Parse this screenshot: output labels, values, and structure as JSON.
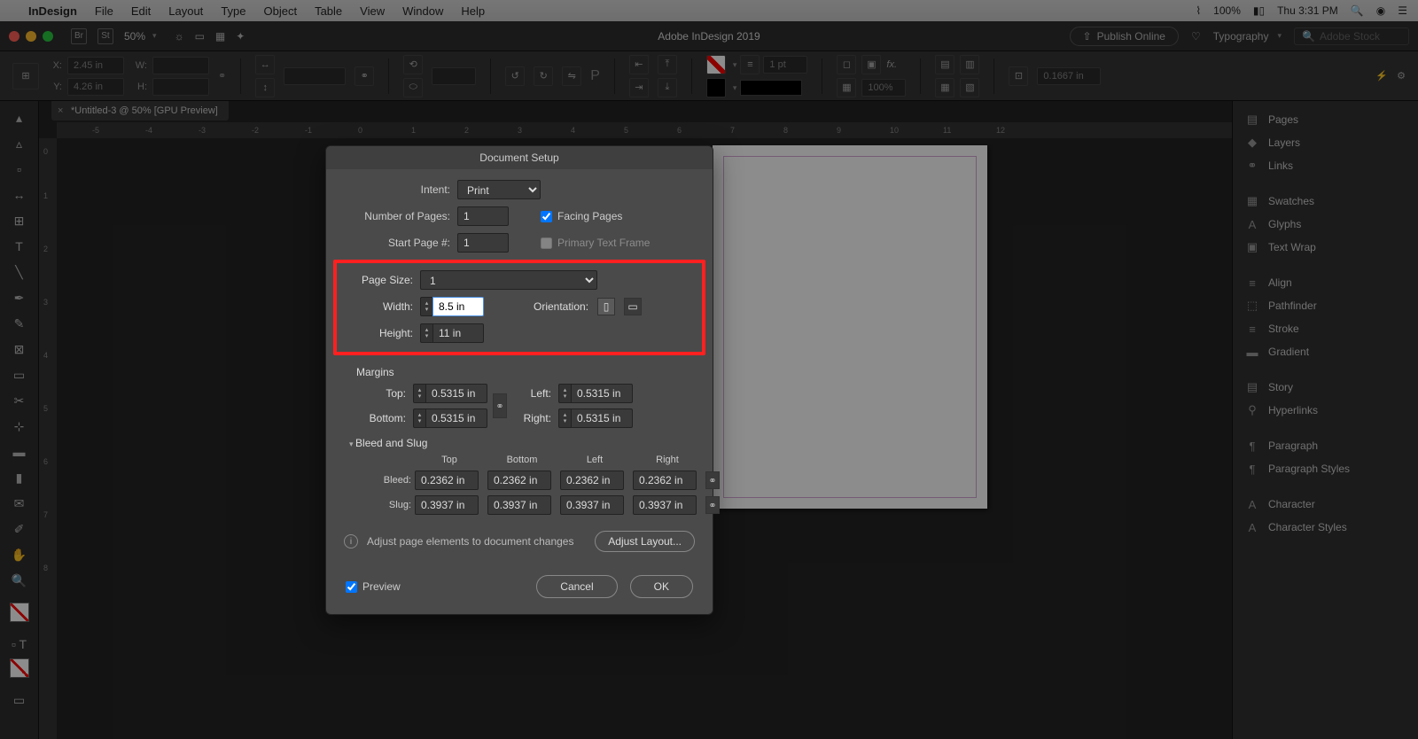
{
  "menubar": {
    "app": "InDesign",
    "items": [
      "File",
      "Edit",
      "Layout",
      "Type",
      "Object",
      "Table",
      "View",
      "Window",
      "Help"
    ],
    "battery": "100%",
    "clock": "Thu 3:31 PM"
  },
  "appbar": {
    "zoom": "50%",
    "title": "Adobe InDesign 2019",
    "publish": "Publish Online",
    "workspace": "Typography",
    "search_placeholder": "Adobe Stock"
  },
  "controlbar": {
    "x": "2.45 in",
    "y": "4.26 in",
    "w": "",
    "h": "",
    "stroke_pt": "1 pt",
    "opacity": "100%",
    "grid_val": "0.1667 in"
  },
  "doc_tab": "*Untitled-3 @ 50% [GPU Preview]",
  "ruler_h": [
    "-5",
    "-4",
    "-3",
    "-2",
    "-1",
    "0",
    "1",
    "2",
    "3",
    "4",
    "5",
    "6",
    "7",
    "8",
    "9",
    "10",
    "11",
    "12"
  ],
  "ruler_v": [
    "0",
    "1",
    "2",
    "3",
    "4",
    "5",
    "6",
    "7",
    "8"
  ],
  "panels": [
    "Pages",
    "Layers",
    "Links",
    "",
    "Swatches",
    "Glyphs",
    "Text Wrap",
    "",
    "Align",
    "Pathfinder",
    "Stroke",
    "Gradient",
    "",
    "Story",
    "Hyperlinks",
    "",
    "Paragraph",
    "Paragraph Styles",
    "",
    "Character",
    "Character Styles"
  ],
  "dialog": {
    "title": "Document Setup",
    "intent_label": "Intent:",
    "intent_value": "Print",
    "num_pages_label": "Number of Pages:",
    "num_pages": "1",
    "start_page_label": "Start Page #:",
    "start_page": "1",
    "facing_pages": "Facing Pages",
    "primary_frame": "Primary Text Frame",
    "page_size_label": "Page Size:",
    "page_size_value": "1",
    "width_label": "Width:",
    "width": "8.5 in",
    "height_label": "Height:",
    "height": "11 in",
    "orientation_label": "Orientation:",
    "margins_label": "Margins",
    "margin_top_label": "Top:",
    "margin_bottom_label": "Bottom:",
    "margin_left_label": "Left:",
    "margin_right_label": "Right:",
    "margin_value": "0.5315 in",
    "bleed_slug_label": "Bleed and Slug",
    "col_top": "Top",
    "col_bottom": "Bottom",
    "col_left": "Left",
    "col_right": "Right",
    "bleed_label": "Bleed:",
    "bleed_value": "0.2362 in",
    "slug_label": "Slug:",
    "slug_value": "0.3937 in",
    "adjust_text": "Adjust page elements to document changes",
    "adjust_btn": "Adjust Layout...",
    "preview": "Preview",
    "cancel": "Cancel",
    "ok": "OK"
  }
}
